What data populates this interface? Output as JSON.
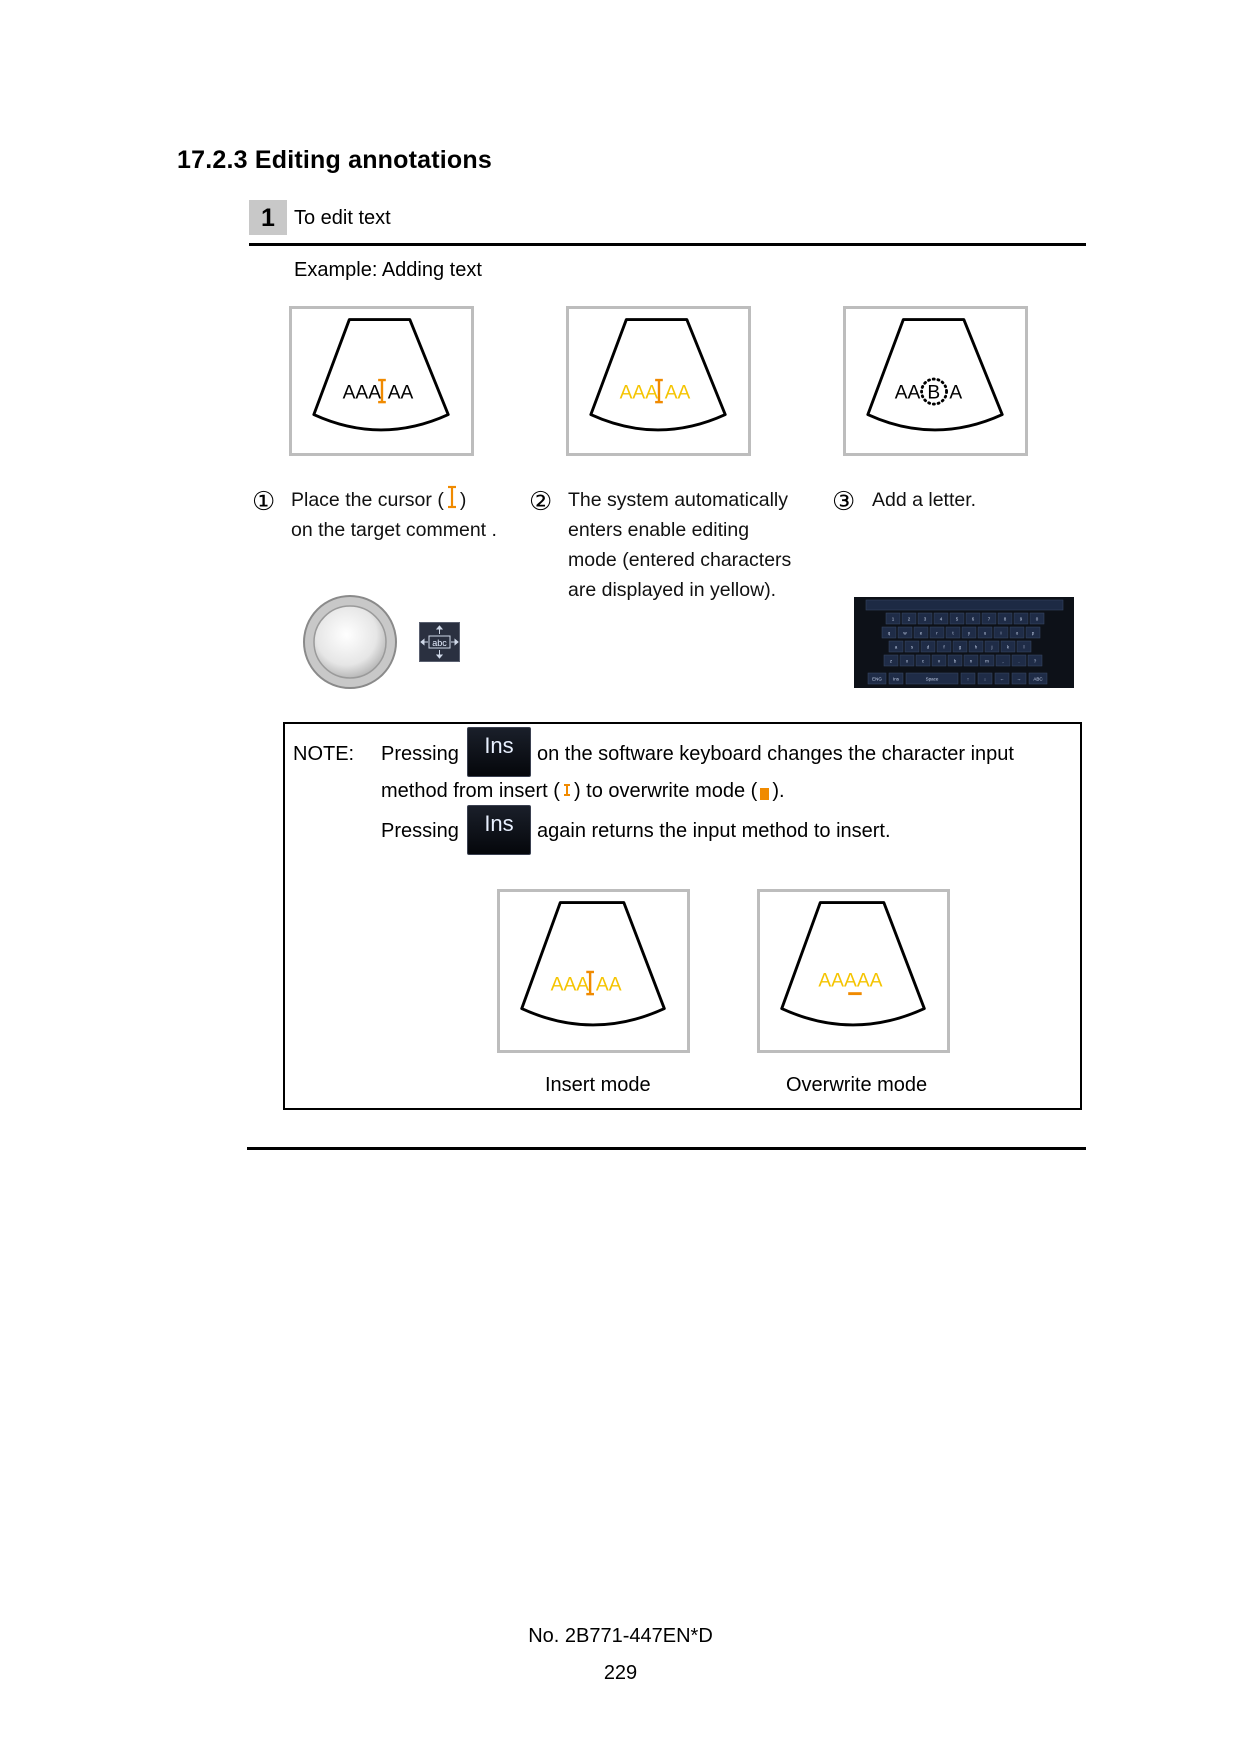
{
  "section": {
    "title": "17.2.3 Editing annotations"
  },
  "step": {
    "number": "1",
    "label": "To edit text"
  },
  "example_label": "Example:  Adding text",
  "panels": [
    {
      "text_left": "AAA",
      "text_right": "AA",
      "caption_num": "①",
      "caption": [
        "Place the cursor (",
        ")",
        "on the target comment ."
      ]
    },
    {
      "text_left": "AAA",
      "text_right": "AA",
      "caption_num": "②",
      "caption": [
        "The system automatically",
        "enters enable editing",
        "mode (entered characters",
        "are displayed in yellow)."
      ]
    },
    {
      "text_left": "AA",
      "text_mid": "B",
      "text_right": "A",
      "caption_num": "③",
      "caption": [
        "Add a letter."
      ]
    }
  ],
  "controls": {
    "abc_label": "abc"
  },
  "keyboard": {
    "row_numbers": [
      "1",
      "2",
      "3",
      "4",
      "5",
      "6",
      "7",
      "8",
      "9",
      "0"
    ],
    "row_q": [
      "q",
      "w",
      "e",
      "r",
      "t",
      "y",
      "u",
      "i",
      "o",
      "p"
    ],
    "row_a": [
      "a",
      "s",
      "d",
      "f",
      "g",
      "h",
      "j",
      "k",
      "l"
    ],
    "row_z": [
      "z",
      "x",
      "c",
      "v",
      "b",
      "n",
      "m",
      ",",
      ".",
      "?"
    ],
    "bottom_keys": [
      "ENG",
      "Ins",
      "Space",
      "↑",
      "↓",
      "←",
      "→",
      "ABC"
    ]
  },
  "note": {
    "label": "NOTE:",
    "pressing": "Pressing",
    "ins_key": "Ins",
    "line1_rest": "on the software keyboard changes the character input",
    "line2_a": "method from insert (",
    "line2_b": ") to overwrite mode (",
    "line2_c": ").",
    "line3_rest": "again returns the input method to insert.",
    "insert_text": "AAA",
    "insert_text_right": "AA",
    "overwrite_text": "AAAAA",
    "insert_caption": "Insert mode",
    "overwrite_caption": "Overwrite mode"
  },
  "colors": {
    "yellow": "#f5c400",
    "orange": "#f08a00",
    "frame": "#bdbdbd"
  },
  "footer": {
    "doc_number": "No. 2B771-447EN*D",
    "page": "229"
  }
}
